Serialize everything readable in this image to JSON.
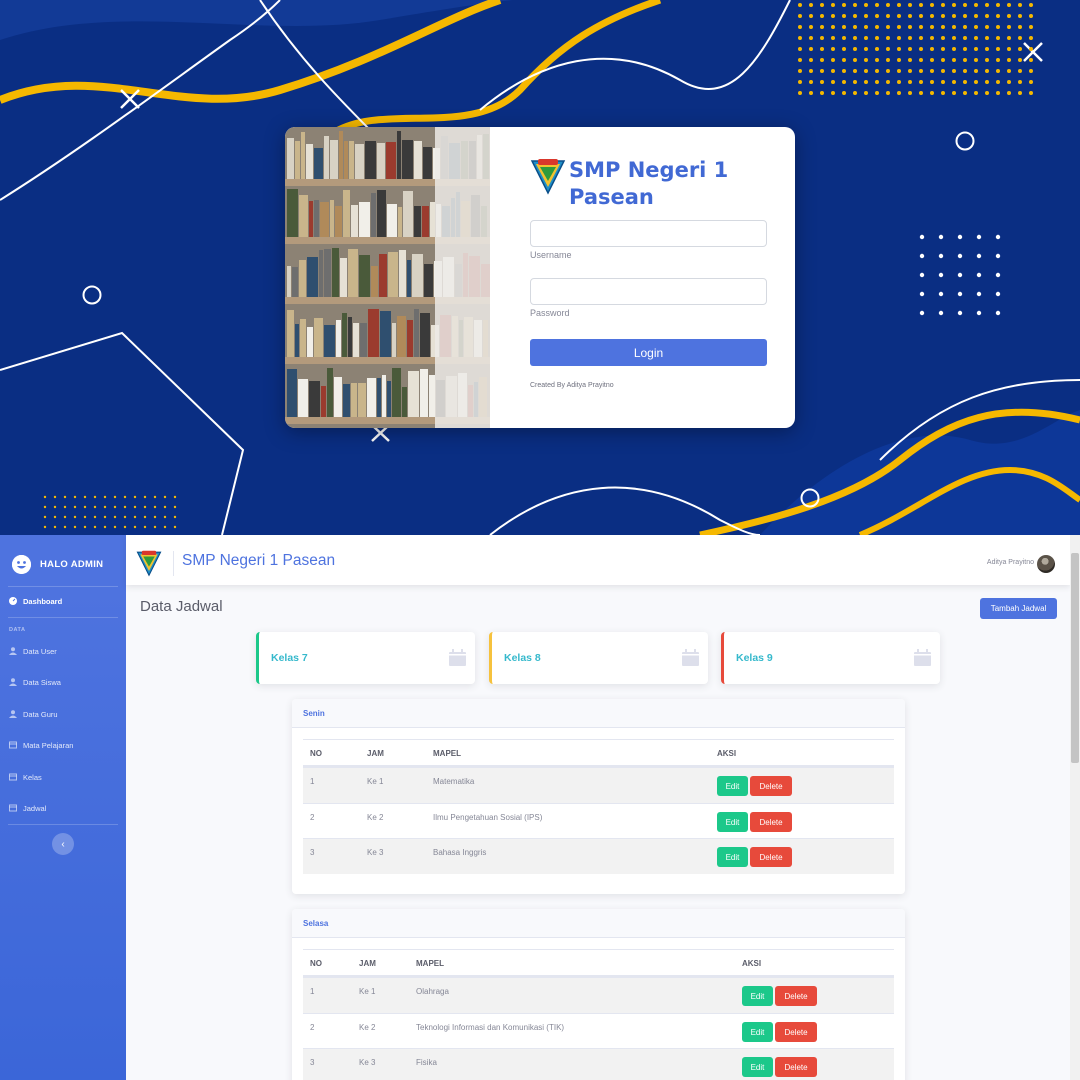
{
  "login": {
    "school_name": "SMP Negeri 1 Pasean",
    "username_label": "Username",
    "username_value": "",
    "password_label": "Password",
    "password_value": "",
    "login_button": "Login",
    "credit": "Created By Aditya Prayitno"
  },
  "sidebar": {
    "brand": "HALO ADMIN",
    "dashboard": "Dashboard",
    "heading": "DATA",
    "items": [
      {
        "label": "Data User",
        "icon": "user-icon"
      },
      {
        "label": "Data Siswa",
        "icon": "user-icon"
      },
      {
        "label": "Data Guru",
        "icon": "user-icon"
      },
      {
        "label": "Mata Pelajaran",
        "icon": "table-icon"
      },
      {
        "label": "Kelas",
        "icon": "table-icon"
      },
      {
        "label": "Jadwal",
        "icon": "table-icon"
      }
    ],
    "toggle": "‹"
  },
  "topbar": {
    "title": "SMP Negeri 1 Pasean",
    "user_name": "Aditya Prayitno"
  },
  "main": {
    "page_title": "Data Jadwal",
    "add_button": "Tambah Jadwal",
    "kelas": [
      {
        "label": "Kelas 7",
        "color": "#1cc88a"
      },
      {
        "label": "Kelas 8",
        "color": "#f6c23e"
      },
      {
        "label": "Kelas 9",
        "color": "#e74a3b"
      }
    ],
    "days": [
      {
        "title": "Senin",
        "headers": [
          "NO",
          "JAM",
          "MAPEL",
          "AKSI"
        ],
        "rows": [
          {
            "no": "1",
            "jam": "Ke 1",
            "mapel": "Matematika"
          },
          {
            "no": "2",
            "jam": "Ke 2",
            "mapel": "Ilmu Pengetahuan Sosial (IPS)"
          },
          {
            "no": "3",
            "jam": "Ke 3",
            "mapel": "Bahasa Inggris"
          }
        ]
      },
      {
        "title": "Selasa",
        "headers": [
          "NO",
          "JAM",
          "MAPEL",
          "AKSI"
        ],
        "rows": [
          {
            "no": "1",
            "jam": "Ke 1",
            "mapel": "Olahraga"
          },
          {
            "no": "2",
            "jam": "Ke 2",
            "mapel": "Teknologi Informasi dan Komunikasi (TIK)"
          },
          {
            "no": "3",
            "jam": "Ke 3",
            "mapel": "Fisika"
          }
        ]
      }
    ],
    "edit_label": "Edit",
    "delete_label": "Delete"
  },
  "colors": {
    "primary": "#4e73df",
    "success": "#1cc88a",
    "danger": "#e74a3b",
    "info": "#36b9cc",
    "login_background": "#0a2e83",
    "accent_wave": "#f5b800"
  }
}
